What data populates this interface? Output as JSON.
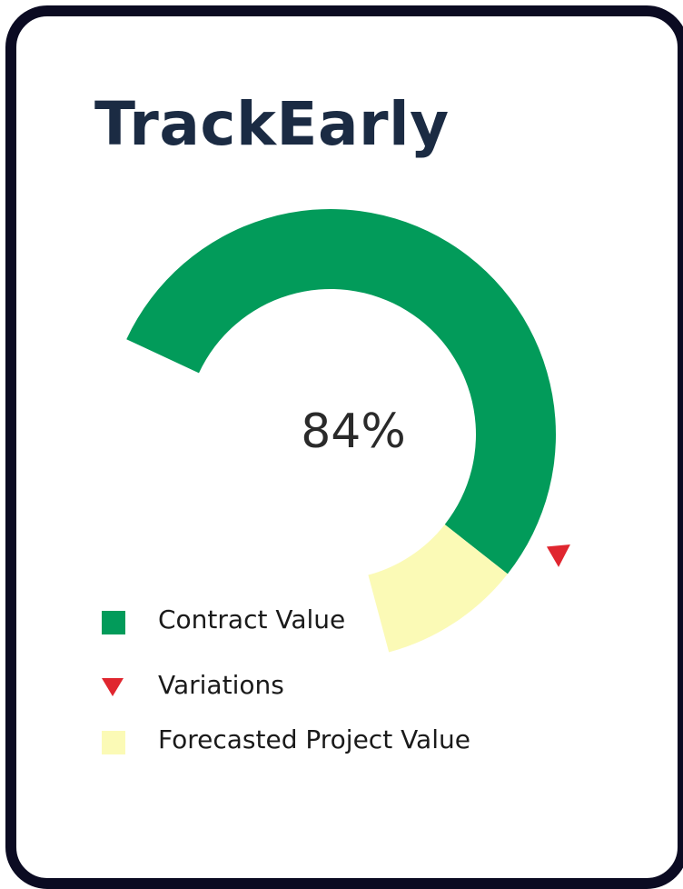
{
  "title": "TrackEarly",
  "chart_data": {
    "type": "gauge",
    "center_label": "84%",
    "value_percent": 84,
    "series": [
      {
        "name": "Contract Value",
        "color": "#029b5a",
        "share": 84
      },
      {
        "name": "Forecasted Project Value",
        "color": "#fbfab6",
        "share": 16
      }
    ],
    "variations_marker": {
      "name": "Variations",
      "color": "#e0262f",
      "at_percent": 88
    }
  },
  "legend": [
    {
      "label": "Contract Value",
      "color": "#029b5a",
      "shape": "square"
    },
    {
      "label": "Variations",
      "color": "#e0262f",
      "shape": "triangle-down"
    },
    {
      "label": "Forecasted Project Value",
      "color": "#fbfab6",
      "shape": "square"
    }
  ]
}
